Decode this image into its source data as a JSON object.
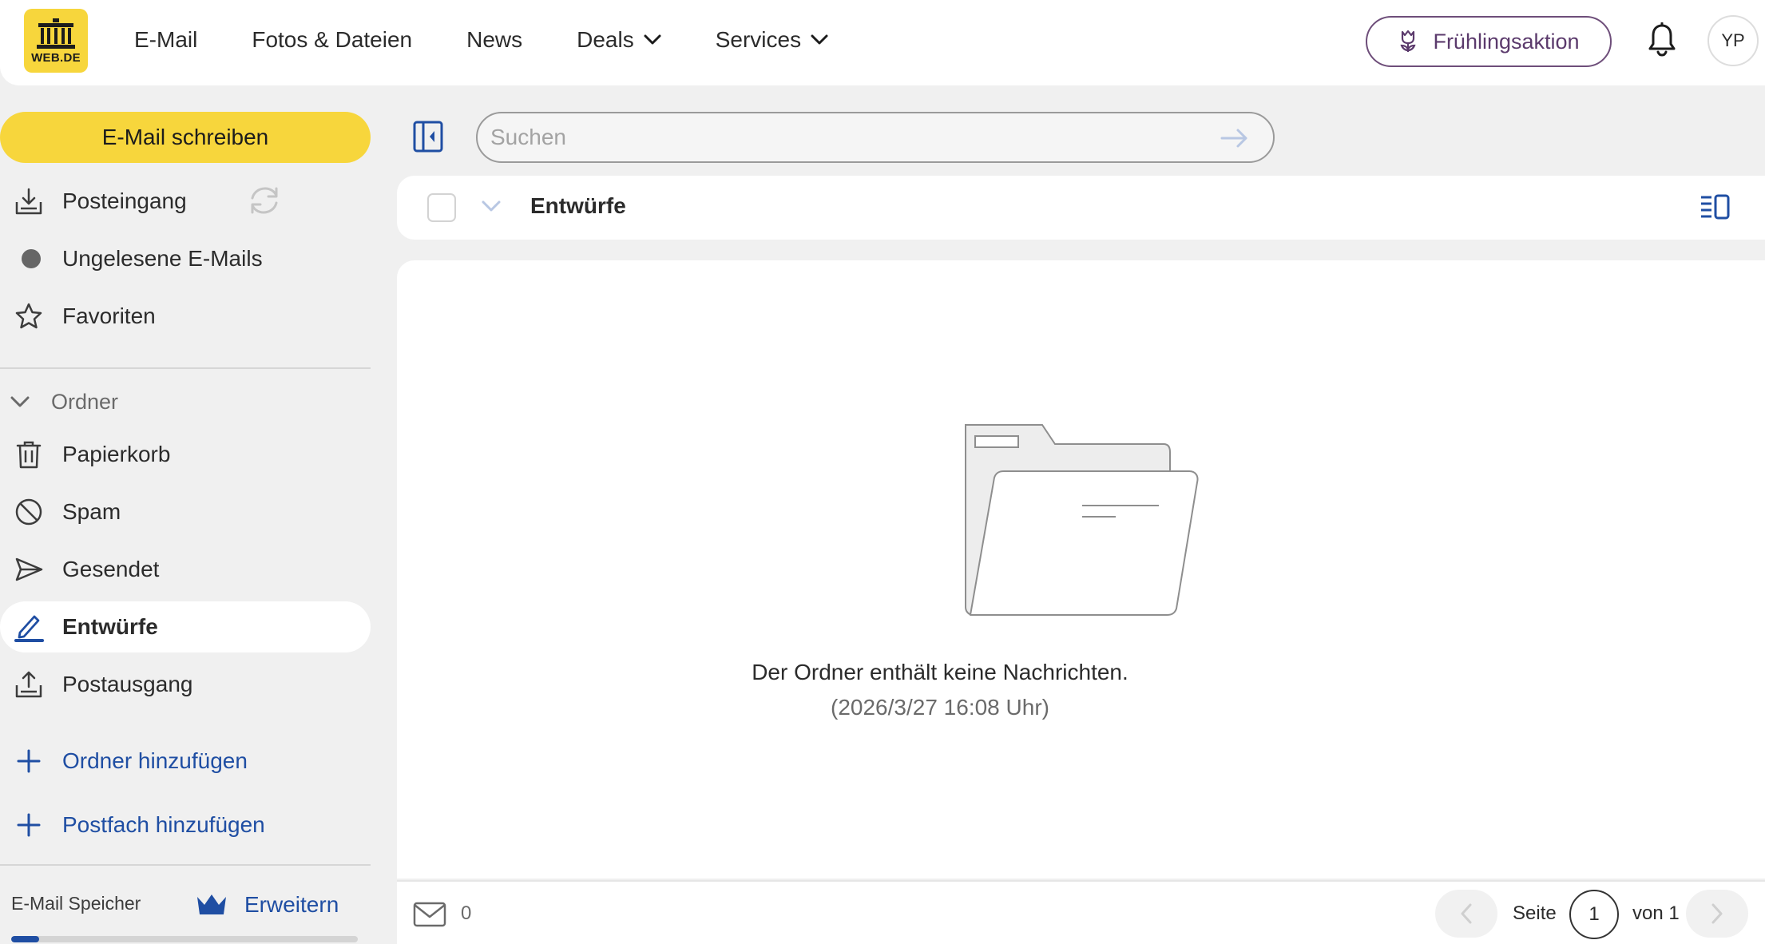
{
  "header": {
    "logo_text": "WEB.DE",
    "nav": [
      {
        "label": "E-Mail"
      },
      {
        "label": "Fotos & Dateien"
      },
      {
        "label": "News"
      },
      {
        "label": "Deals"
      },
      {
        "label": "Services"
      }
    ],
    "promo_label": "Frühlingsaktion",
    "avatar_initials": "YP"
  },
  "sidebar": {
    "compose_label": "E-Mail schreiben",
    "quick": [
      {
        "label": "Posteingang"
      },
      {
        "label": "Ungelesene E-Mails"
      },
      {
        "label": "Favoriten"
      }
    ],
    "folders_heading": "Ordner",
    "folders": [
      {
        "label": "Papierkorb"
      },
      {
        "label": "Spam"
      },
      {
        "label": "Gesendet"
      },
      {
        "label": "Entwürfe",
        "active": true
      },
      {
        "label": "Postausgang"
      }
    ],
    "add_folder_label": "Ordner hinzufügen",
    "add_mailbox_label": "Postfach hinzufügen",
    "storage_label": "E-Mail Speicher",
    "storage_upgrade_label": "Erweitern",
    "storage_used_fraction": 0.08
  },
  "search": {
    "placeholder": "Suchen",
    "value": ""
  },
  "list": {
    "title": "Entwürfe",
    "empty_message": "Der Ordner enthält keine Nachrichten.",
    "empty_timestamp": "(2026/3/27 16:08 Uhr)"
  },
  "footer": {
    "mail_count": "0",
    "page_label": "Seite",
    "page_current": "1",
    "page_of": "von 1"
  },
  "colors": {
    "brand_yellow": "#f7d63c",
    "link_blue": "#1f4ea3",
    "promo_purple": "#5b3a6c"
  }
}
